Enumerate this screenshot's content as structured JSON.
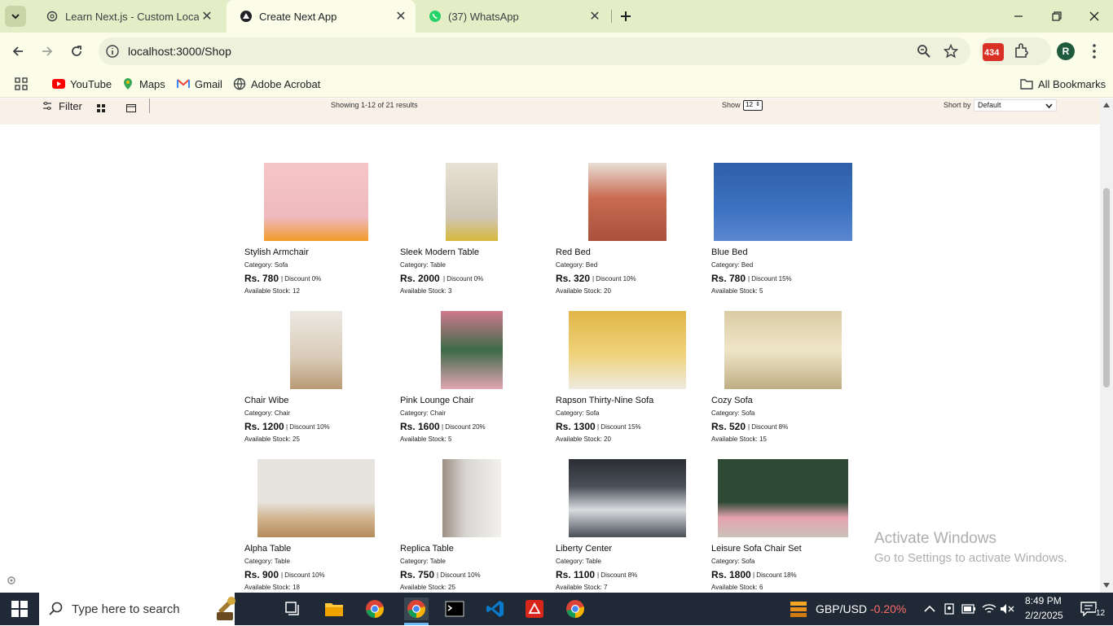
{
  "browser": {
    "tabs": [
      {
        "title": "Learn Next.js - Custom Localhost",
        "active": false,
        "icon": "openai-icon"
      },
      {
        "title": "Create Next App",
        "active": true,
        "icon": "nextjs-triangle-icon"
      },
      {
        "title": "(37) WhatsApp",
        "active": false,
        "icon": "whatsapp-icon"
      }
    ],
    "url": "localhost:3000/Shop",
    "extension_badge": "434",
    "profile_initial": "R",
    "bookmarks": [
      "YouTube",
      "Maps",
      "Gmail",
      "Adobe Acrobat"
    ],
    "all_bookmarks": "All Bookmarks"
  },
  "filterbar": {
    "filter_label": "Filter",
    "showing": "Showing 1-12 of 21 results",
    "show_label": "Show",
    "show_value": "12",
    "sort_label": "Short by",
    "sort_value": "Default"
  },
  "products": [
    {
      "name": "Stylish Armchair",
      "category": "Category: Sofa",
      "price": "Rs. 780",
      "discount": "| Discount 0%",
      "stock": "Available Stock: 12",
      "img_colors": [
        "#f4c6c8",
        "#f0b9bd",
        "#f29a2a"
      ]
    },
    {
      "name": "Sleek Modern Table",
      "category": "Category: Table",
      "price": "Rs. 2000",
      "discount": "| Discount 0%",
      "stock": "Available Stock: 3",
      "img_colors": [
        "#e8e2d6",
        "#cfc6b5",
        "#d8b83a"
      ]
    },
    {
      "name": "Red Bed",
      "category": "Category: Bed",
      "price": "Rs. 320",
      "discount": "| Discount 10%",
      "stock": "Available Stock: 20",
      "img_colors": [
        "#e9dfd6",
        "#c96b52",
        "#a9503c"
      ]
    },
    {
      "name": "Blue Bed",
      "category": "Category: Bed",
      "price": "Rs. 780",
      "discount": "| Discount 15%",
      "stock": "Available Stock: 5",
      "img_colors": [
        "#2f5fa8",
        "#3c73c2",
        "#5c86d0"
      ]
    },
    {
      "name": "Chair Wibe",
      "category": "Category: Chair",
      "price": "Rs. 1200",
      "discount": "| Discount 10%",
      "stock": "Available Stock: 25",
      "img_colors": [
        "#ece8e2",
        "#d9cbb8",
        "#b89a74"
      ]
    },
    {
      "name": "Pink Lounge Chair",
      "category": "Category: Chair",
      "price": "Rs. 1600",
      "discount": "| Discount 20%",
      "stock": "Available Stock: 5",
      "img_colors": [
        "#cf7a8c",
        "#e3a5b2",
        "#3d6a4a"
      ]
    },
    {
      "name": "Rapson Thirty-Nine Sofa",
      "category": "Category: Sofa",
      "price": "Rs. 1300",
      "discount": "| Discount 15%",
      "stock": "Available Stock: 20",
      "img_colors": [
        "#e0b647",
        "#f0d27a",
        "#eeeae0"
      ]
    },
    {
      "name": "Cozy Sofa",
      "category": "Category: Sofa",
      "price": "Rs. 520",
      "discount": "| Discount 8%",
      "stock": "Available Stock: 15",
      "img_colors": [
        "#d9cba4",
        "#efe6c8",
        "#bfae84"
      ]
    },
    {
      "name": "Alpha Table",
      "category": "Category: Table",
      "price": "Rs. 900",
      "discount": "| Discount 10%",
      "stock": "Available Stock: 18",
      "img_colors": [
        "#e6e3de",
        "#d3b691",
        "#b48a5a"
      ]
    },
    {
      "name": "Replica Table",
      "category": "Category: Table",
      "price": "Rs. 750",
      "discount": "| Discount 10%",
      "stock": "Available Stock: 25",
      "img_colors": [
        "#d8d6d2",
        "#f3f1ee",
        "#9c8f82"
      ]
    },
    {
      "name": "Liberty Center",
      "category": "Category: Table",
      "price": "Rs. 1100",
      "discount": "| Discount 8%",
      "stock": "Available Stock: 7",
      "img_colors": [
        "#4a4f58",
        "#d9dde0",
        "#2b2e33"
      ]
    },
    {
      "name": "Leisure Sofa Chair Set",
      "category": "Category: Sofa",
      "price": "Rs. 1800",
      "discount": "| Discount 18%",
      "stock": "Available Stock: 6",
      "img_colors": [
        "#2e4a35",
        "#e6a3b0",
        "#c9c2b8"
      ]
    }
  ],
  "watermark": {
    "line1": "Activate Windows",
    "line2": "Go to Settings to activate Windows."
  },
  "taskbar": {
    "search_placeholder": "Type here to search",
    "ticker_pair": "GBP/USD",
    "ticker_change": "-0.20%",
    "ticker_color": "#ff6b6b",
    "time": "8:49 PM",
    "date": "2/2/2025",
    "notifications": "12"
  }
}
